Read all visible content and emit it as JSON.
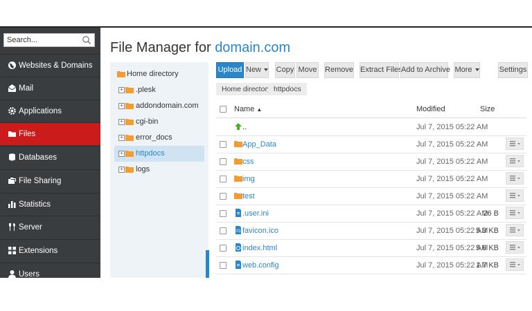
{
  "sidebar": {
    "search_placeholder": "Search...",
    "items": [
      {
        "label": "Websites & Domains",
        "icon": "globe-icon"
      },
      {
        "label": "Mail",
        "icon": "mail-icon"
      },
      {
        "label": "Applications",
        "icon": "gear-icon"
      },
      {
        "label": "Files",
        "icon": "folder-icon",
        "active": true
      },
      {
        "label": "Databases",
        "icon": "database-icon"
      },
      {
        "label": "File Sharing",
        "icon": "file-sharing-icon"
      },
      {
        "label": "Statistics",
        "icon": "bar-chart-icon"
      },
      {
        "label": "Server",
        "icon": "tools-icon"
      },
      {
        "label": "Extensions",
        "icon": "extensions-icon"
      },
      {
        "label": "Users",
        "icon": "user-icon"
      }
    ]
  },
  "header": {
    "title_prefix": "File Manager for",
    "domain": "domain.com"
  },
  "tree": [
    {
      "label": "Home directory"
    },
    {
      "label": ".plesk"
    },
    {
      "label": "addondomain.com"
    },
    {
      "label": "cgi-bin"
    },
    {
      "label": "error_docs"
    },
    {
      "label": "httpdocs",
      "selected": true
    },
    {
      "label": "logs"
    }
  ],
  "toolbar": {
    "upload": "Upload",
    "new": "New",
    "copy": "Copy",
    "move": "Move",
    "remove": "Remove",
    "extract": "Extract Files",
    "archive": "Add to Archive",
    "more": "More",
    "settings": "Settings"
  },
  "breadcrumb": [
    "Home directory",
    "httpdocs"
  ],
  "table": {
    "columns": {
      "name": "Name",
      "modified": "Modified",
      "size": "Size"
    },
    "rows": [
      {
        "name": "..",
        "modified": "Jul 7, 2015 05:22 AM",
        "size": "",
        "icon": "up-arrow-icon"
      },
      {
        "name": "App_Data",
        "modified": "Jul 7, 2015 05:22 AM",
        "size": "",
        "icon": "folder-icon"
      },
      {
        "name": "css",
        "modified": "Jul 7, 2015 05:22 AM",
        "size": "",
        "icon": "folder-icon"
      },
      {
        "name": "img",
        "modified": "Jul 7, 2015 05:22 AM",
        "size": "",
        "icon": "folder-icon"
      },
      {
        "name": "test",
        "modified": "Jul 7, 2015 05:22 AM",
        "size": "",
        "icon": "folder-icon"
      },
      {
        "name": ".user.ini",
        "modified": "Jul 7, 2015 05:22 AM",
        "size": "26 B",
        "icon": "file-icon"
      },
      {
        "name": "favicon.ico",
        "modified": "Jul 7, 2015 05:22 AM",
        "size": "5.3 KB",
        "icon": "binary-file-icon"
      },
      {
        "name": "index.html",
        "modified": "Jul 7, 2015 05:22 AM",
        "size": "5.6 KB",
        "icon": "html-file-icon"
      },
      {
        "name": "web.config",
        "modified": "Jul 7, 2015 05:22 AM",
        "size": "1.7 KB",
        "icon": "file-icon"
      }
    ]
  },
  "colors": {
    "accent": "#2a86c8",
    "active_nav": "#cc1b1b",
    "sidebar": "#3a3d40",
    "folder": "#f39c33"
  }
}
